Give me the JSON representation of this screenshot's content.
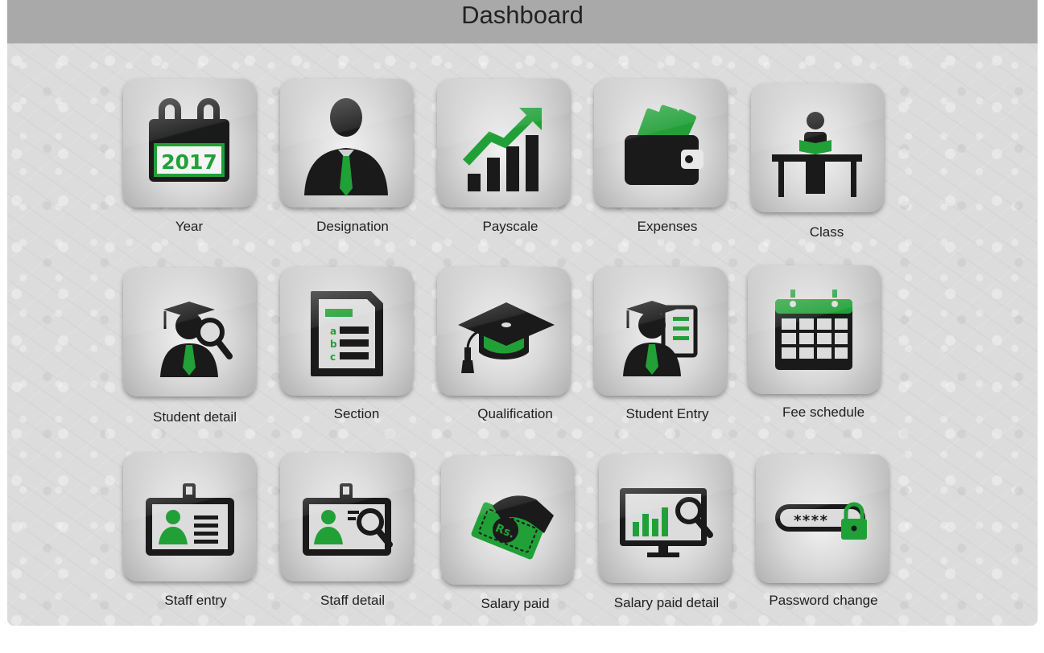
{
  "header": {
    "title": "Dashboard"
  },
  "year_icon_text": "2017",
  "password_mask": "****",
  "money_text": "Rs.",
  "section_letters": [
    "a",
    "b",
    "c"
  ],
  "colors": {
    "accent": "#21a038",
    "dark": "#1a1a1a",
    "header_bg": "#a9a9a9"
  },
  "tiles": [
    {
      "label": "Year",
      "icon": "calendar-year-icon"
    },
    {
      "label": "Designation",
      "icon": "businessman-icon"
    },
    {
      "label": "Payscale",
      "icon": "growth-chart-icon"
    },
    {
      "label": "Expenses",
      "icon": "wallet-icon"
    },
    {
      "label": "Class",
      "icon": "reading-student-icon"
    },
    {
      "label": "Student detail",
      "icon": "student-search-icon"
    },
    {
      "label": "Section",
      "icon": "document-list-icon"
    },
    {
      "label": "Qualification",
      "icon": "graduation-cap-icon"
    },
    {
      "label": "Student Entry",
      "icon": "student-form-icon"
    },
    {
      "label": "Fee schedule",
      "icon": "calendar-grid-icon"
    },
    {
      "label": "Staff entry",
      "icon": "id-card-icon"
    },
    {
      "label": "Staff detail",
      "icon": "id-card-search-icon"
    },
    {
      "label": "Salary paid",
      "icon": "money-hand-icon"
    },
    {
      "label": "Salary paid detail",
      "icon": "monitor-chart-search-icon"
    },
    {
      "label": "Password change",
      "icon": "password-lock-icon"
    }
  ]
}
